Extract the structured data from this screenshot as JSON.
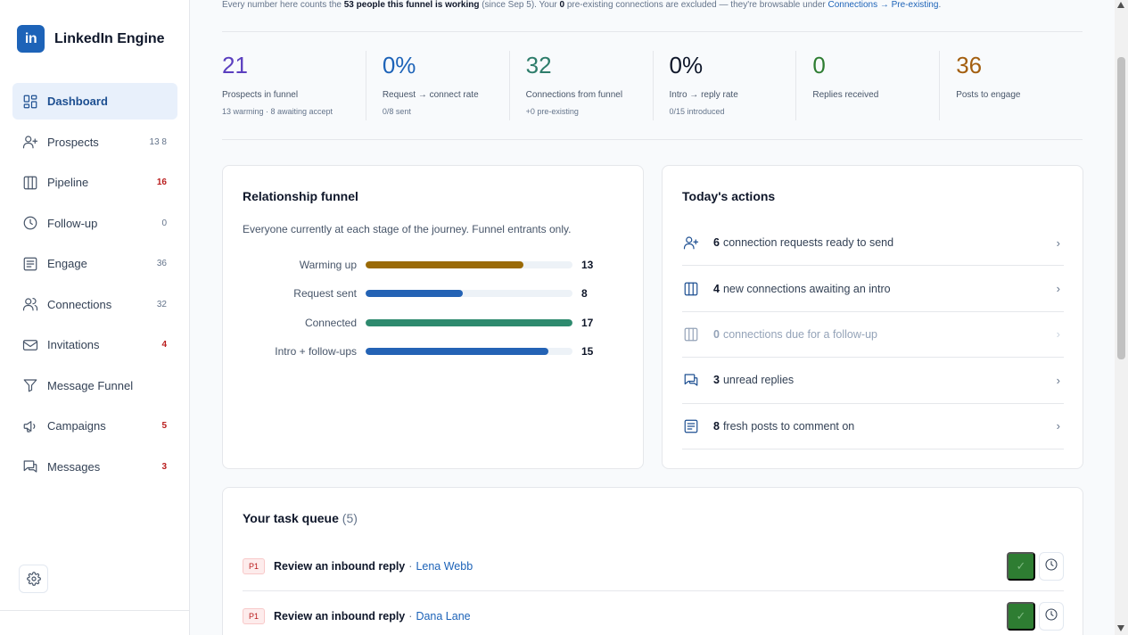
{
  "brand": {
    "logo": "in",
    "name": "LinkedIn Engine"
  },
  "nav": [
    {
      "label": "Dashboard",
      "icon": "dashboard-icon",
      "badge": "",
      "badge_red": false,
      "active": true
    },
    {
      "label": "Prospects",
      "icon": "user-plus-icon",
      "badge": "13 8",
      "badge_red": false,
      "active": false
    },
    {
      "label": "Pipeline",
      "icon": "columns-icon",
      "badge": "16",
      "badge_red": true,
      "active": false
    },
    {
      "label": "Follow-up",
      "icon": "clock-icon",
      "badge": "0",
      "badge_red": false,
      "active": false
    },
    {
      "label": "Engage",
      "icon": "post-icon",
      "badge": "36",
      "badge_red": false,
      "active": false
    },
    {
      "label": "Connections",
      "icon": "users-icon",
      "badge": "32",
      "badge_red": false,
      "active": false
    },
    {
      "label": "Invitations",
      "icon": "mail-icon",
      "badge": "4",
      "badge_red": true,
      "active": false
    },
    {
      "label": "Message Funnel",
      "icon": "funnel-icon",
      "badge": "",
      "badge_red": false,
      "active": false
    },
    {
      "label": "Campaigns",
      "icon": "megaphone-icon",
      "badge": "5",
      "badge_red": true,
      "active": false
    },
    {
      "label": "Messages",
      "icon": "chat-icon",
      "badge": "3",
      "badge_red": true,
      "active": false
    }
  ],
  "notice": {
    "p1": "Every number here counts the ",
    "b1": "53 people this funnel is working",
    "p2": " (since Sep 5). Your ",
    "b2": "0",
    "p3": " pre-existing connections are excluded — they're browsable under ",
    "link": "Connections → Pre-existing",
    "p4": "."
  },
  "stats": [
    {
      "value": "21",
      "label": "Prospects in funnel",
      "sub": "13 warming · 8 awaiting accept",
      "color": "#5b3fbf"
    },
    {
      "value": "0%",
      "label": "Request → connect rate",
      "sub": "0/8 sent",
      "color": "#1d63b8"
    },
    {
      "value": "32",
      "label": "Connections from funnel",
      "sub": "+0 pre-existing",
      "color": "#2e7d6b"
    },
    {
      "value": "0%",
      "label": "Intro → reply rate",
      "sub": "0/15 introduced",
      "color": "#0f172a"
    },
    {
      "value": "0",
      "label": "Replies received",
      "sub": "",
      "color": "#2e7d32"
    },
    {
      "value": "36",
      "label": "Posts to engage",
      "sub": "",
      "color": "#a35f10"
    }
  ],
  "funnel": {
    "title": "Relationship funnel",
    "desc": "Everyone currently at each stage of the journey. Funnel entrants only.",
    "max": 17,
    "stages": [
      {
        "label": "Warming up",
        "value": 13,
        "color": "#9a6a06"
      },
      {
        "label": "Request sent",
        "value": 8,
        "color": "#2463b5"
      },
      {
        "label": "Connected",
        "value": 17,
        "color": "#2e8a6e"
      },
      {
        "label": "Intro + follow-ups",
        "value": 15,
        "color": "#2463b5"
      }
    ]
  },
  "actions": {
    "title": "Today's actions",
    "items": [
      {
        "count": "6",
        "text": "connection requests ready to send",
        "icon": "user-plus-icon",
        "dim": false
      },
      {
        "count": "4",
        "text": "new connections awaiting an intro",
        "icon": "columns-icon",
        "dim": false
      },
      {
        "count": "0",
        "text": "connections due for a follow-up",
        "icon": "columns-icon",
        "dim": true
      },
      {
        "count": "3",
        "text": "unread replies",
        "icon": "chat-icon",
        "dim": false
      },
      {
        "count": "8",
        "text": "fresh posts to comment on",
        "icon": "post-icon",
        "dim": false
      }
    ],
    "chevron": "›"
  },
  "queue": {
    "title": "Your task queue",
    "count": "(5)",
    "tasks": [
      {
        "priority": "P1",
        "title": "Review an inbound reply",
        "sep": "·",
        "person": "Lena Webb"
      },
      {
        "priority": "P1",
        "title": "Review an inbound reply",
        "sep": "·",
        "person": "Dana Lane"
      }
    ],
    "done_glyph": "✓"
  },
  "scrollbar": {
    "position": 0.09
  }
}
